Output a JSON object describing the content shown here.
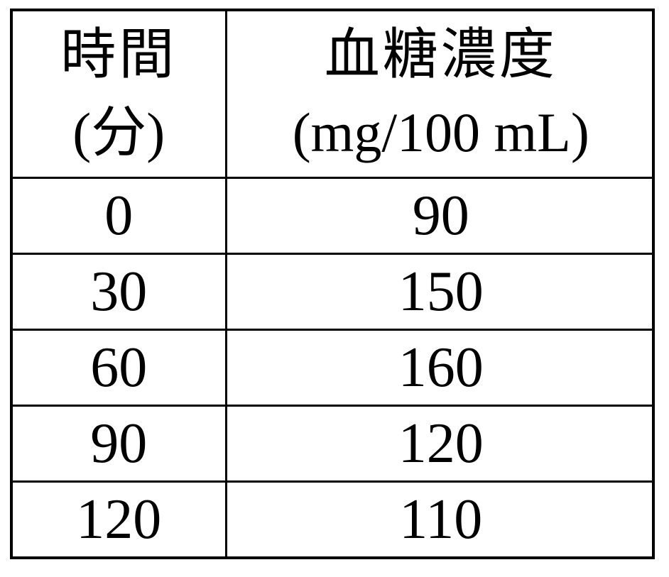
{
  "table": {
    "headers": [
      {
        "line1": "時間",
        "line2": "(分)"
      },
      {
        "line1": "血糖濃度",
        "line2": "(mg/100 mL)"
      }
    ],
    "rows": [
      [
        "0",
        "90"
      ],
      [
        "30",
        "150"
      ],
      [
        "60",
        "160"
      ],
      [
        "90",
        "120"
      ],
      [
        "120",
        "110"
      ]
    ]
  },
  "chart_data": {
    "type": "table",
    "columns": [
      "時間 (分)",
      "血糖濃度 (mg/100 mL)"
    ],
    "rows": [
      [
        0,
        90
      ],
      [
        30,
        150
      ],
      [
        60,
        160
      ],
      [
        90,
        120
      ],
      [
        120,
        110
      ]
    ]
  }
}
